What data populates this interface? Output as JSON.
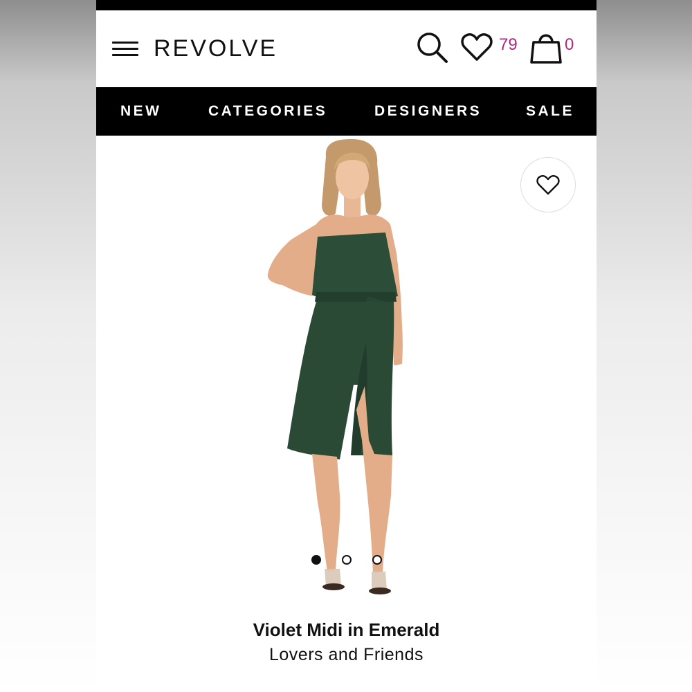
{
  "header": {
    "logo": "REVOLVE",
    "wishlist_count": "79",
    "bag_count": "0",
    "badge_color": "#b3267f"
  },
  "nav": {
    "items": [
      {
        "label": "NEW"
      },
      {
        "label": "CATEGORIES"
      },
      {
        "label": "DESIGNERS"
      },
      {
        "label": "SALE"
      }
    ]
  },
  "product": {
    "name": "Violet Midi in Emerald",
    "brand": "Lovers and Friends",
    "dress_color": "#2a4a36",
    "image_count": 3,
    "active_image": 1
  },
  "icons": {
    "menu": "hamburger-menu-icon",
    "search": "search-icon",
    "wishlist": "heart-icon",
    "bag": "shopping-bag-icon"
  }
}
